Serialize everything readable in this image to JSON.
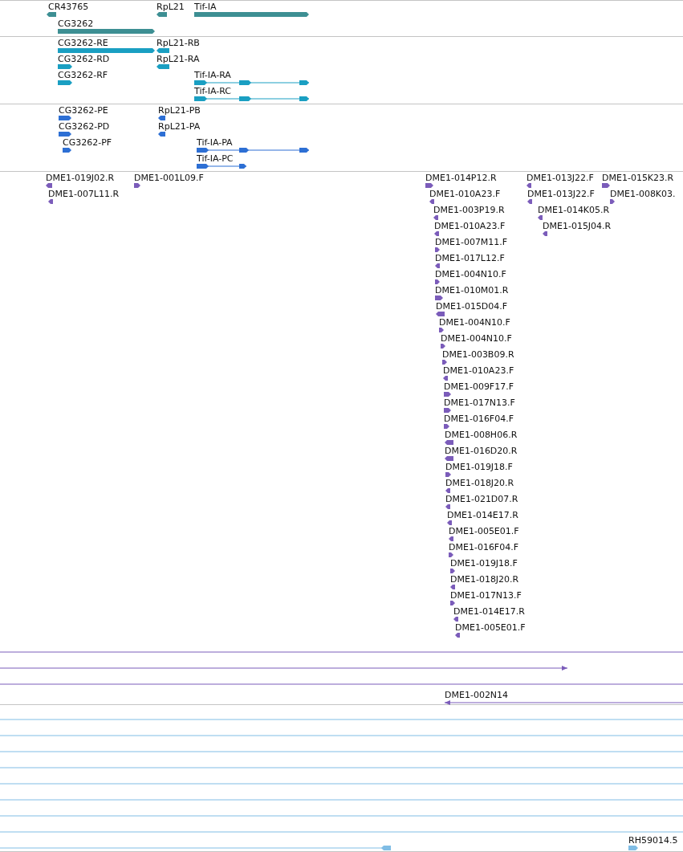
{
  "tracks": [
    {
      "kind": "gene",
      "features": [
        {
          "label": "CR43765",
          "kind": "arrow",
          "reverse": true
        },
        {
          "label": "RpL21",
          "kind": "arrow",
          "reverse": true
        },
        {
          "label": "Tif-IA",
          "kind": "arrow",
          "reverse": false
        },
        {
          "label": "CG3262",
          "kind": "arrow",
          "reverse": false
        }
      ]
    },
    {
      "kind": "transcript",
      "features": [
        {
          "label": "CG3262-RE",
          "kind": "arrow",
          "reverse": false
        },
        {
          "label": "RpL21-RB",
          "kind": "arrow",
          "reverse": true
        },
        {
          "label": "CG3262-RD",
          "kind": "arrow",
          "reverse": false
        },
        {
          "label": "RpL21-RA",
          "kind": "arrow",
          "reverse": true
        },
        {
          "label": "CG3262-RF",
          "kind": "arrow",
          "reverse": false
        },
        {
          "label": "Tif-IA-RA",
          "kind": "arrow",
          "reverse": false
        },
        {
          "label": "Tif-IA-RC",
          "kind": "arrow",
          "reverse": false
        }
      ]
    },
    {
      "kind": "protein",
      "features": [
        {
          "label": "CG3262-PE",
          "kind": "arrow",
          "reverse": false
        },
        {
          "label": "RpL21-PB",
          "kind": "arrow",
          "reverse": true
        },
        {
          "label": "CG3262-PD",
          "kind": "arrow",
          "reverse": false
        },
        {
          "label": "RpL21-PA",
          "kind": "arrow",
          "reverse": true
        },
        {
          "label": "CG3262-PF",
          "kind": "arrow",
          "reverse": false
        },
        {
          "label": "Tif-IA-PA",
          "kind": "arrow",
          "reverse": false
        },
        {
          "label": "Tif-IA-PC",
          "kind": "arrow",
          "reverse": false
        }
      ]
    },
    {
      "kind": "est",
      "features": [
        {
          "label": "DME1-019J02.R",
          "kind": "arrow",
          "reverse": true
        },
        {
          "label": "DME1-001L09.F",
          "kind": "arrow",
          "reverse": false
        },
        {
          "label": "DME1-014P12.R",
          "kind": "arrow",
          "reverse": false
        },
        {
          "label": "DME1-013J22.F",
          "kind": "arrow",
          "reverse": true
        },
        {
          "label": "DME1-015K23.R",
          "kind": "arrow",
          "reverse": false
        },
        {
          "label": "DME1-007L11.R",
          "kind": "arrow",
          "reverse": true
        },
        {
          "label": "DME1-010A23.F",
          "kind": "arrow",
          "reverse": true
        },
        {
          "label": "DME1-013J22.F",
          "kind": "arrow",
          "reverse": true
        },
        {
          "label": "DME1-008K03.",
          "kind": "arrow",
          "reverse": false
        },
        {
          "label": "DME1-003P19.R",
          "kind": "arrow",
          "reverse": true
        },
        {
          "label": "DME1-014K05.R",
          "kind": "arrow",
          "reverse": true
        },
        {
          "label": "DME1-010A23.F",
          "kind": "arrow",
          "reverse": true
        },
        {
          "label": "DME1-015J04.R",
          "kind": "arrow",
          "reverse": true
        },
        {
          "label": "DME1-007M11.F",
          "kind": "arrow",
          "reverse": false
        },
        {
          "label": "DME1-017L12.F",
          "kind": "arrow",
          "reverse": true
        },
        {
          "label": "DME1-004N10.F",
          "kind": "arrow",
          "reverse": false
        },
        {
          "label": "DME1-010M01.R",
          "kind": "arrow",
          "reverse": false
        },
        {
          "label": "DME1-015D04.F",
          "kind": "arrow",
          "reverse": true
        },
        {
          "label": "DME1-004N10.F",
          "kind": "arrow",
          "reverse": false
        },
        {
          "label": "DME1-004N10.F",
          "kind": "arrow",
          "reverse": false
        },
        {
          "label": "DME1-003B09.R",
          "kind": "arrow",
          "reverse": false
        },
        {
          "label": "DME1-010A23.F",
          "kind": "arrow",
          "reverse": true
        },
        {
          "label": "DME1-009F17.F",
          "kind": "arrow",
          "reverse": false
        },
        {
          "label": "DME1-017N13.F",
          "kind": "arrow",
          "reverse": false
        },
        {
          "label": "DME1-016F04.F",
          "kind": "arrow",
          "reverse": false
        },
        {
          "label": "DME1-008H06.R",
          "kind": "arrow",
          "reverse": true
        },
        {
          "label": "DME1-016D20.R",
          "kind": "arrow",
          "reverse": true
        },
        {
          "label": "DME1-019J18.F",
          "kind": "arrow",
          "reverse": false
        },
        {
          "label": "DME1-018J20.R",
          "kind": "arrow",
          "reverse": true
        },
        {
          "label": "DME1-021D07.R",
          "kind": "arrow",
          "reverse": true
        },
        {
          "label": "DME1-014E17.R",
          "kind": "arrow",
          "reverse": true
        },
        {
          "label": "DME1-005E01.F",
          "kind": "arrow",
          "reverse": true
        },
        {
          "label": "DME1-016F04.F",
          "kind": "arrow",
          "reverse": false
        },
        {
          "label": "DME1-019J18.F",
          "kind": "arrow",
          "reverse": false
        },
        {
          "label": "DME1-018J20.R",
          "kind": "arrow",
          "reverse": true
        },
        {
          "label": "DME1-017N13.F",
          "kind": "arrow",
          "reverse": false
        },
        {
          "label": "DME1-014E17.R",
          "kind": "arrow",
          "reverse": true
        },
        {
          "label": "DME1-005E01.F",
          "kind": "arrow",
          "reverse": true
        },
        {
          "kind": "span"
        },
        {
          "kind": "arrow",
          "reverse": false
        },
        {
          "kind": "span"
        },
        {
          "label": "DME1-002N14",
          "kind": "arrow",
          "reverse": true
        }
      ]
    },
    {
      "kind": "cdna",
      "features": [
        {
          "kind": "span"
        },
        {
          "kind": "span"
        },
        {
          "kind": "span"
        },
        {
          "kind": "span"
        },
        {
          "kind": "span"
        },
        {
          "kind": "span"
        },
        {
          "kind": "span"
        },
        {
          "kind": "span"
        },
        {
          "kind": "arrow",
          "reverse": true
        },
        {
          "label": "RH59014.5",
          "kind": "arrow",
          "reverse": false
        }
      ]
    }
  ]
}
